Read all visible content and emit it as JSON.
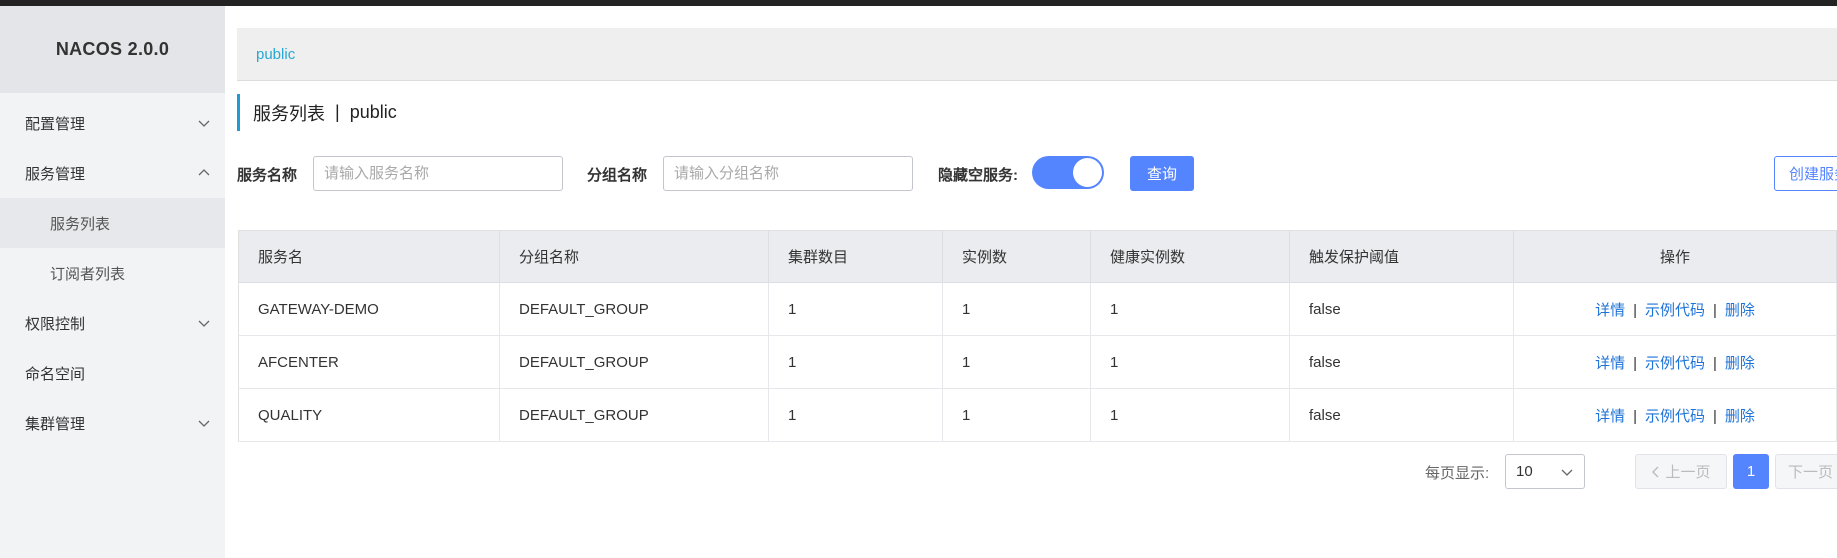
{
  "app": {
    "brand": "NACOS 2.0.0"
  },
  "sidebar": {
    "items": [
      {
        "label": "配置管理"
      },
      {
        "label": "服务管理"
      },
      {
        "label": "服务列表"
      },
      {
        "label": "订阅者列表"
      },
      {
        "label": "权限控制"
      },
      {
        "label": "命名空间"
      },
      {
        "label": "集群管理"
      }
    ]
  },
  "breadcrumb": {
    "namespace": "public"
  },
  "page": {
    "title": "服务列表",
    "separator": "|",
    "namespace": "public"
  },
  "filters": {
    "service_label": "服务名称",
    "service_placeholder": "请输入服务名称",
    "group_label": "分组名称",
    "group_placeholder": "请输入分组名称",
    "hide_empty_label": "隐藏空服务:",
    "hide_empty_on": true,
    "query_button": "查询",
    "create_button": "创建服务"
  },
  "table": {
    "headers": [
      "服务名",
      "分组名称",
      "集群数目",
      "实例数",
      "健康实例数",
      "触发保护阈值",
      "操作"
    ],
    "rows": [
      {
        "name": "GATEWAY-DEMO",
        "group": "DEFAULT_GROUP",
        "clusters": "1",
        "instances": "1",
        "healthy": "1",
        "threshold": "false"
      },
      {
        "name": "AFCENTER",
        "group": "DEFAULT_GROUP",
        "clusters": "1",
        "instances": "1",
        "healthy": "1",
        "threshold": "false"
      },
      {
        "name": "QUALITY",
        "group": "DEFAULT_GROUP",
        "clusters": "1",
        "instances": "1",
        "healthy": "1",
        "threshold": "false"
      }
    ],
    "actions": {
      "detail": "详情",
      "sample": "示例代码",
      "delete": "删除",
      "separator": "|"
    }
  },
  "pagination": {
    "per_page_label": "每页显示:",
    "per_page_value": "10",
    "prev": "上一页",
    "current": "1",
    "next": "下一页"
  },
  "colors": {
    "primary": "#5584ff",
    "accent": "#209bd3",
    "link": "#1e73d8"
  }
}
